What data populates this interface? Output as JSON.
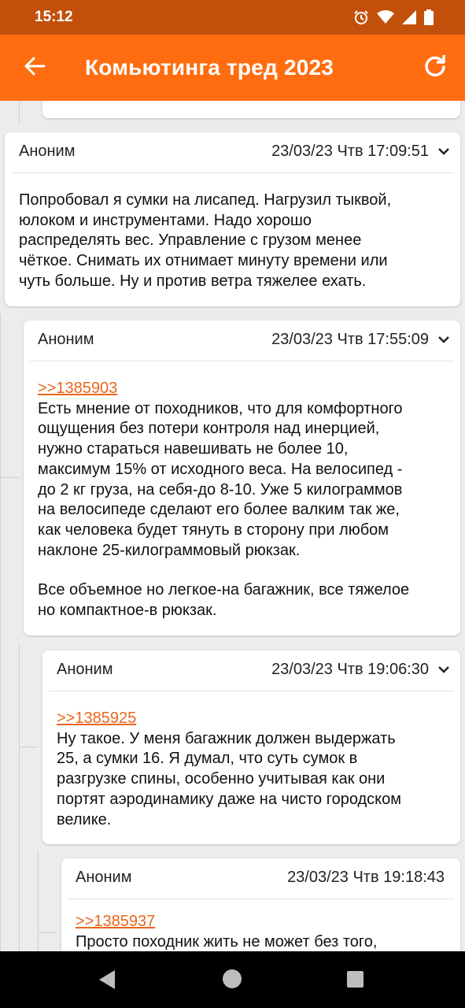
{
  "status_bar": {
    "time": "15:12",
    "icons": [
      "alarm-icon",
      "wifi-icon",
      "signal-icon",
      "battery-icon"
    ],
    "bg_color": "#c2500a"
  },
  "app_bar": {
    "title": "Комьютинга тред 2023",
    "back_icon": "arrow-left-icon",
    "refresh_icon": "refresh-icon",
    "bg_color": "#ff6d10"
  },
  "posts": [
    {
      "author": "Аноним",
      "date": "23/03/23 Чтв 17:09:51",
      "lines": [
        "Попробовал я сумки на лисапед. Нагрузил тыквой,",
        "юлоком и инструментами. Надо хорошо",
        "распределять вес. Управление с грузом менее",
        "чёткое. Снимать их отнимает минуту времени или",
        "чуть больше. Ну и против ветра тяжелее ехать."
      ]
    },
    {
      "author": "Аноним",
      "date": "23/03/23 Чтв 17:55:09",
      "reply_link": ">>1385903",
      "lines": [
        "Есть мнение от походников, что для комфортного",
        "ощущения без потери контроля над инерцией,",
        "нужно стараться навешивать не более 10,",
        "максимум 15% от исходного веса. На велосипед -",
        "до 2 кг груза, на себя-до 8-10. Уже 5 килограммов",
        "на велосипеде сделают его более валким так же,",
        "как человека будет тянуть в сторону при любом",
        "наклоне 25-килограммовый рюкзак."
      ],
      "lines2": [
        "Все объемное но легкое-на багажник, все тяжелое",
        "но компактное-в рюкзак."
      ]
    },
    {
      "author": "Аноним",
      "date": "23/03/23 Чтв 19:06:30",
      "reply_link": ">>1385925",
      "lines": [
        "Ну такое. У меня багажник должен выдержать",
        "25, а сумки 16. Я думал, что суть сумок в",
        "разгрузке спины, особенно учитывая как они",
        "портят аэродинамику даже на чисто городском",
        "велике."
      ]
    },
    {
      "author": "Аноним",
      "date": "23/03/23 Чтв 19:18:43",
      "reply_link": ">>1385937",
      "lines": [
        "Просто походник жить не может без того,"
      ]
    }
  ],
  "nav_bar": {
    "icons": [
      "back-triangle-icon",
      "home-circle-icon",
      "recents-square-icon"
    ]
  },
  "colors": {
    "link": "#e9661b",
    "background": "#ececec"
  }
}
